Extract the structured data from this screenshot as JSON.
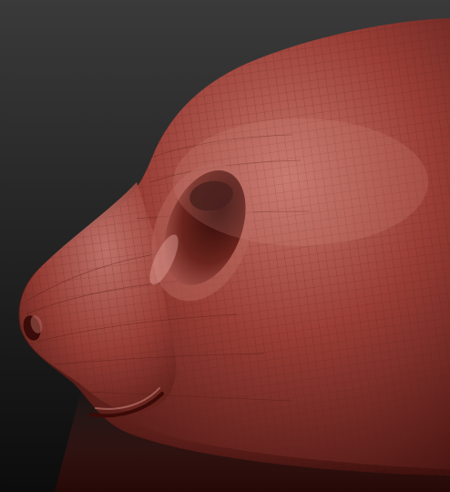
{
  "scene": {
    "subject": "",
    "background_top": "#3a3a3a",
    "background_bottom": "#0c0c0c",
    "material_base": "#9a3e36",
    "material_highlight": "#c7776d",
    "material_shadow": "#4a1512",
    "wire_color": "#5b1d18"
  }
}
